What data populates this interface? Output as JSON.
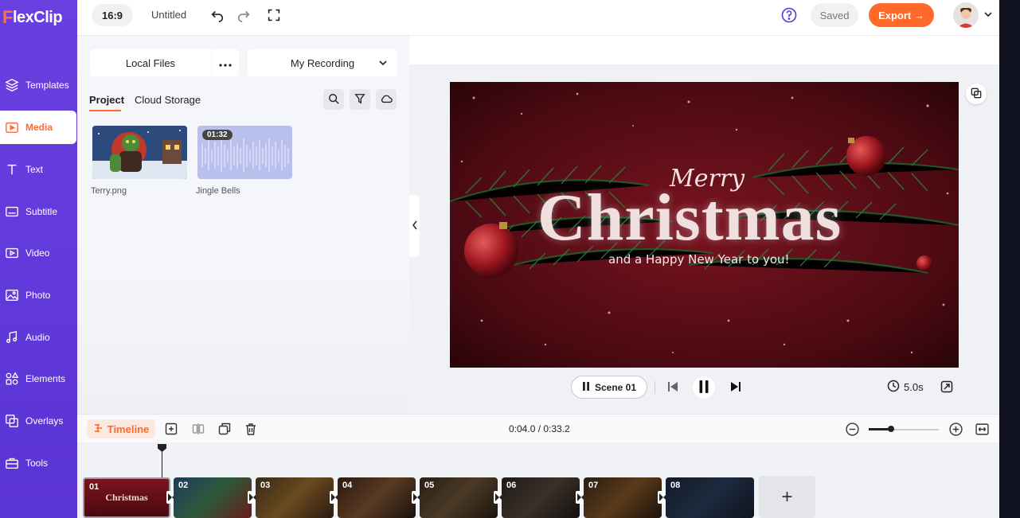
{
  "app": {
    "brand_rest": "lexClip",
    "brand_first": "F"
  },
  "sidebar": {
    "items": [
      {
        "label": "Templates",
        "icon": "layers-icon"
      },
      {
        "label": "Media",
        "icon": "media-icon"
      },
      {
        "label": "Text",
        "icon": "text-icon"
      },
      {
        "label": "Subtitle",
        "icon": "subtitle-icon"
      },
      {
        "label": "Video",
        "icon": "video-icon"
      },
      {
        "label": "Photo",
        "icon": "photo-icon"
      },
      {
        "label": "Audio",
        "icon": "audio-icon"
      },
      {
        "label": "Elements",
        "icon": "elements-icon"
      },
      {
        "label": "Overlays",
        "icon": "overlays-icon"
      },
      {
        "label": "Tools",
        "icon": "tools-icon"
      }
    ],
    "active": "Media"
  },
  "topbar": {
    "ratio": "16:9",
    "title": "Untitled",
    "saved": "Saved",
    "export": "Export →"
  },
  "media": {
    "local_files": "Local Files",
    "recording": "My Recording",
    "tabs": [
      "Project",
      "Cloud Storage"
    ],
    "items": [
      {
        "name": "Terry.png"
      },
      {
        "name": "Jingle Bells",
        "duration": "01:32"
      }
    ]
  },
  "preview": {
    "title_script": "Merry",
    "title_main": "Christmas",
    "subtitle": "and a Happy New Year to you!",
    "scene_label": "Scene 01",
    "duration": "5.0s"
  },
  "timeline": {
    "label": "Timeline",
    "timecode": "0:04.0 / 0:33.2",
    "scenes": [
      "01",
      "02",
      "03",
      "04",
      "05",
      "06",
      "07",
      "08"
    ],
    "scene1_text": "Christmas",
    "add": "+"
  },
  "colors": {
    "sidebar": "#5b34d6",
    "accent": "#ff6a2b"
  }
}
